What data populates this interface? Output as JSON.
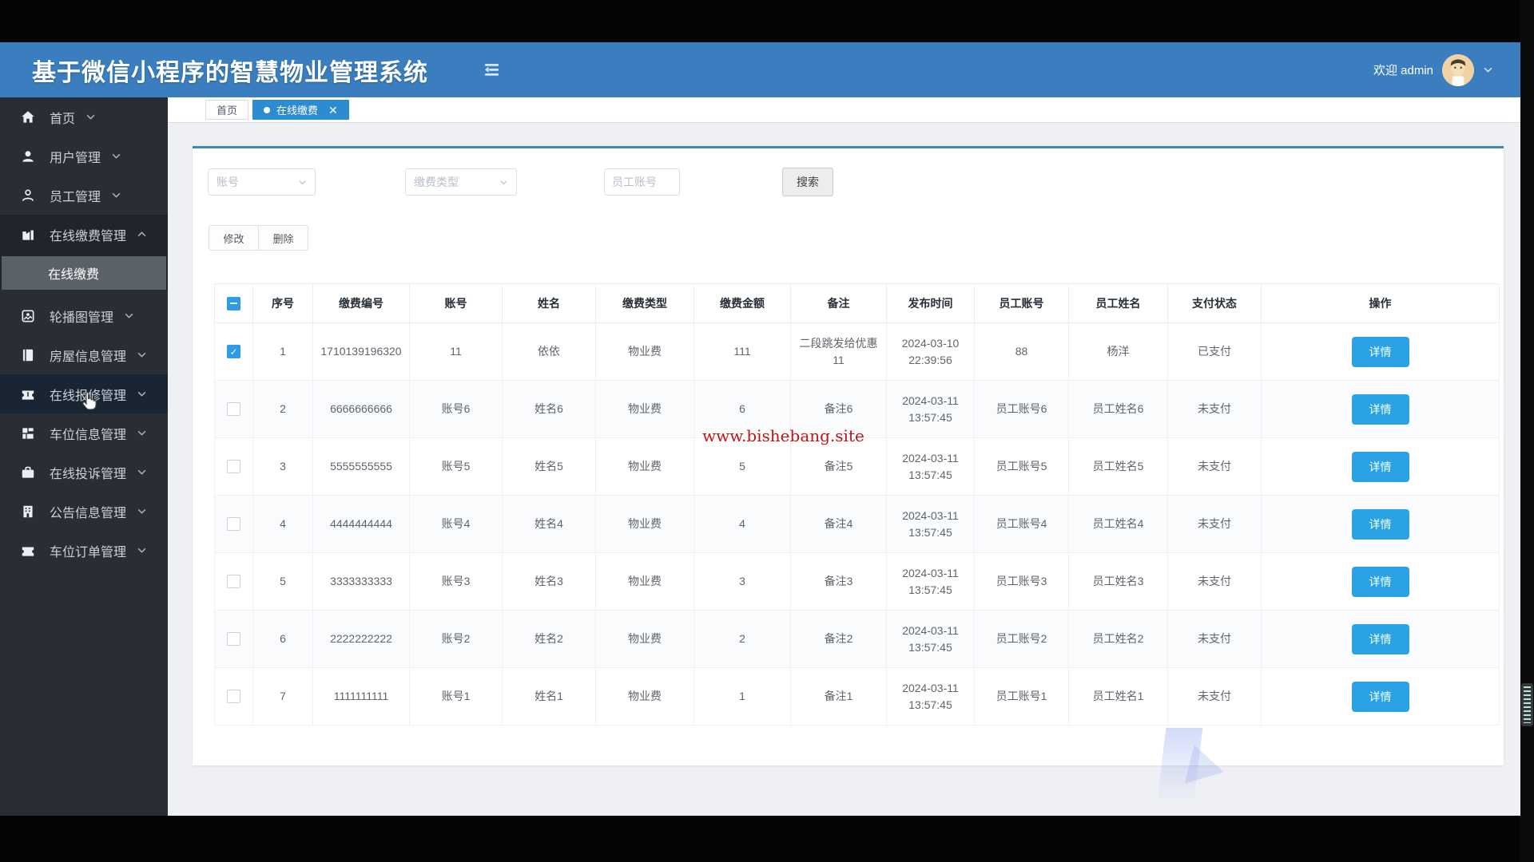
{
  "header": {
    "title": "基于微信小程序的智慧物业管理系统",
    "welcome": "欢迎 admin"
  },
  "sidebar": {
    "items": [
      {
        "icon": "home-icon",
        "label": "首页",
        "chevron": "down"
      },
      {
        "icon": "user-icon",
        "label": "用户管理",
        "chevron": "down"
      },
      {
        "icon": "employee-icon",
        "label": "员工管理",
        "chevron": "down"
      },
      {
        "icon": "payment-icon",
        "label": "在线缴费管理",
        "chevron": "up",
        "expanded": true,
        "submenu": [
          {
            "label": "在线缴费",
            "active": true
          }
        ]
      },
      {
        "icon": "carousel-icon",
        "label": "轮播图管理",
        "chevron": "down"
      },
      {
        "icon": "house-icon",
        "label": "房屋信息管理",
        "chevron": "down"
      },
      {
        "icon": "repair-icon",
        "label": "在线报修管理",
        "chevron": "down",
        "hovered": true
      },
      {
        "icon": "parking-icon",
        "label": "车位信息管理",
        "chevron": "down"
      },
      {
        "icon": "complaint-icon",
        "label": "在线投诉管理",
        "chevron": "down"
      },
      {
        "icon": "notice-icon",
        "label": "公告信息管理",
        "chevron": "down"
      },
      {
        "icon": "order-icon",
        "label": "车位订单管理",
        "chevron": "down"
      }
    ]
  },
  "tabs": {
    "home": "首页",
    "active": "在线缴费"
  },
  "filters": {
    "account": "账号",
    "fee_type": "缴费类型",
    "employee_placeholder": "员工账号",
    "search": "搜索"
  },
  "actions": {
    "edit": "修改",
    "delete": "删除"
  },
  "table": {
    "columns": [
      "序号",
      "缴费编号",
      "账号",
      "姓名",
      "缴费类型",
      "缴费金额",
      "备注",
      "发布时间",
      "员工账号",
      "员工姓名",
      "支付状态",
      "操作"
    ],
    "detail": "详情",
    "rows": [
      {
        "checked": true,
        "seq": "1",
        "payment_no": "1710139196320",
        "account": "11",
        "name": "依依",
        "fee_type": "物业费",
        "amount": "111",
        "remark": "二段跳发给优惠11",
        "publish_time": "2024-03-10 22:39:56",
        "employee_account": "88",
        "employee_name": "杨洋",
        "pay_status": "已支付"
      },
      {
        "checked": false,
        "seq": "2",
        "payment_no": "6666666666",
        "account": "账号6",
        "name": "姓名6",
        "fee_type": "物业费",
        "amount": "6",
        "remark": "备注6",
        "publish_time": "2024-03-11 13:57:45",
        "employee_account": "员工账号6",
        "employee_name": "员工姓名6",
        "pay_status": "未支付"
      },
      {
        "checked": false,
        "seq": "3",
        "payment_no": "5555555555",
        "account": "账号5",
        "name": "姓名5",
        "fee_type": "物业费",
        "amount": "5",
        "remark": "备注5",
        "publish_time": "2024-03-11 13:57:45",
        "employee_account": "员工账号5",
        "employee_name": "员工姓名5",
        "pay_status": "未支付"
      },
      {
        "checked": false,
        "seq": "4",
        "payment_no": "4444444444",
        "account": "账号4",
        "name": "姓名4",
        "fee_type": "物业费",
        "amount": "4",
        "remark": "备注4",
        "publish_time": "2024-03-11 13:57:45",
        "employee_account": "员工账号4",
        "employee_name": "员工姓名4",
        "pay_status": "未支付"
      },
      {
        "checked": false,
        "seq": "5",
        "payment_no": "3333333333",
        "account": "账号3",
        "name": "姓名3",
        "fee_type": "物业费",
        "amount": "3",
        "remark": "备注3",
        "publish_time": "2024-03-11 13:57:45",
        "employee_account": "员工账号3",
        "employee_name": "员工姓名3",
        "pay_status": "未支付"
      },
      {
        "checked": false,
        "seq": "6",
        "payment_no": "2222222222",
        "account": "账号2",
        "name": "姓名2",
        "fee_type": "物业费",
        "amount": "2",
        "remark": "备注2",
        "publish_time": "2024-03-11 13:57:45",
        "employee_account": "员工账号2",
        "employee_name": "员工姓名2",
        "pay_status": "未支付"
      },
      {
        "checked": false,
        "seq": "7",
        "payment_no": "1111111111",
        "account": "账号1",
        "name": "姓名1",
        "fee_type": "物业费",
        "amount": "1",
        "remark": "备注1",
        "publish_time": "2024-03-11 13:57:45",
        "employee_account": "员工账号1",
        "employee_name": "员工姓名1",
        "pay_status": "未支付"
      }
    ]
  },
  "watermark": "www.bishebang.site",
  "colors": {
    "header_blue": "#3a7ebf",
    "tab_blue": "#2d8cd0",
    "button_blue": "#29a3e3",
    "checkbox_blue": "#2d9ce8",
    "watermark_red": "#c01515",
    "card_border_blue": "#3f86c5"
  }
}
